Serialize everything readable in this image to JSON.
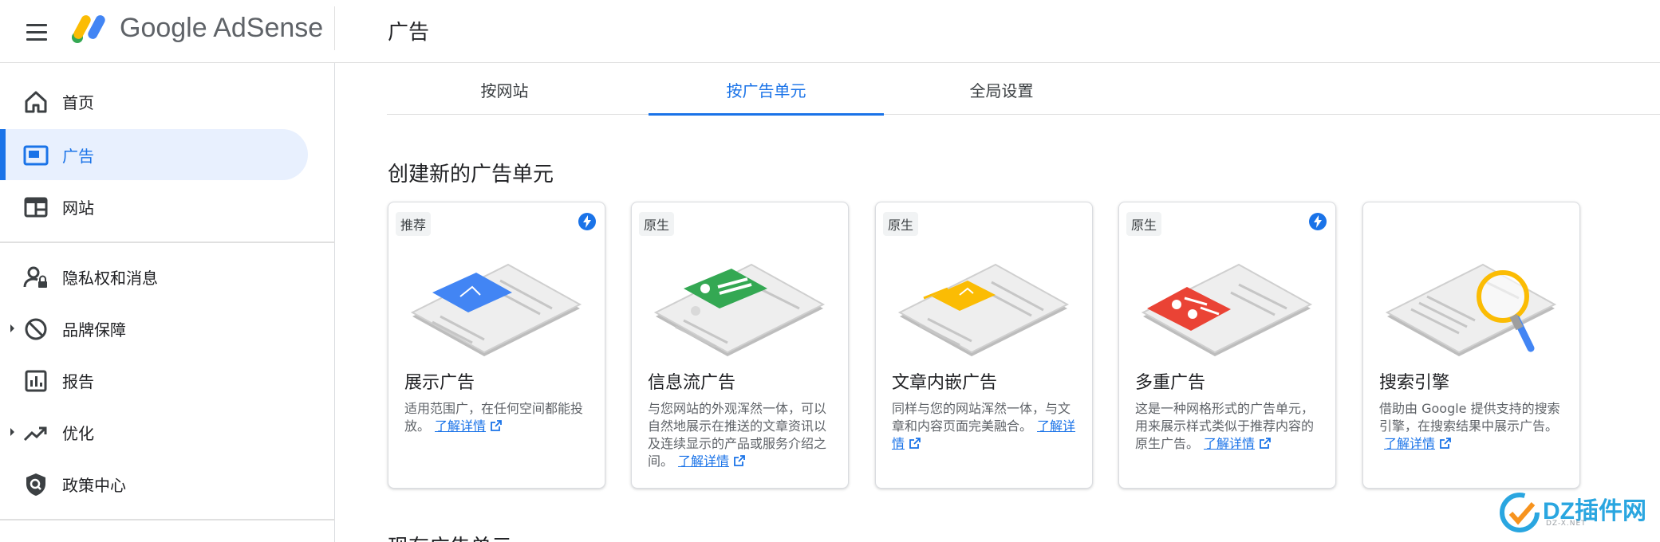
{
  "app": {
    "brand": "Google AdSense",
    "page_title": "广告"
  },
  "sidebar": {
    "items": [
      {
        "label": "首页",
        "icon": "home-icon"
      },
      {
        "label": "广告",
        "icon": "ads-icon"
      },
      {
        "label": "网站",
        "icon": "sites-icon"
      },
      {
        "label": "隐私权和消息",
        "icon": "privacy-icon"
      },
      {
        "label": "品牌保障",
        "icon": "block-icon"
      },
      {
        "label": "报告",
        "icon": "reports-icon"
      },
      {
        "label": "优化",
        "icon": "trending-icon"
      },
      {
        "label": "政策中心",
        "icon": "policy-shield-icon"
      }
    ],
    "active": "广告"
  },
  "tabs": [
    {
      "label": "按网站"
    },
    {
      "label": "按广告单元",
      "active": true
    },
    {
      "label": "全局设置"
    }
  ],
  "section": {
    "title": "创建新的广告单元",
    "next_title": "现有广告单元"
  },
  "cards": [
    {
      "badge": "推荐",
      "bolt": true,
      "title": "展示广告",
      "desc": "适用范围广，在任何空间都能投放。",
      "link": "了解详情",
      "accent": "#4285f4"
    },
    {
      "badge": "原生",
      "bolt": false,
      "title": "信息流广告",
      "desc": "与您网站的外观浑然一体，可以自然地展示在推送的文章资讯以及连续显示的产品或服务介绍之间。",
      "link": "了解详情",
      "accent": "#34a853"
    },
    {
      "badge": "原生",
      "bolt": false,
      "title": "文章内嵌广告",
      "desc": "同样与您的网站浑然一体，与文章和内容页面完美融合。",
      "link": "了解详情",
      "accent": "#fbbc04"
    },
    {
      "badge": "原生",
      "bolt": true,
      "title": "多重广告",
      "desc": "这是一种网格形式的广告单元，用来展示样式类似于推荐内容的原生广告。",
      "link": "了解详情",
      "accent": "#ea4335"
    },
    {
      "badge": "",
      "bolt": false,
      "title": "搜索引擎",
      "desc": "借助由 Google 提供支持的搜索引擎，在搜索结果中展示广告。",
      "link": "了解详情",
      "accent": "#fbbc04"
    }
  ],
  "watermark": {
    "text": "DZ插件网",
    "sub": "DZ-X.NET"
  },
  "colors": {
    "accent": "#1a73e8",
    "active_bg": "#e8f0fe"
  }
}
